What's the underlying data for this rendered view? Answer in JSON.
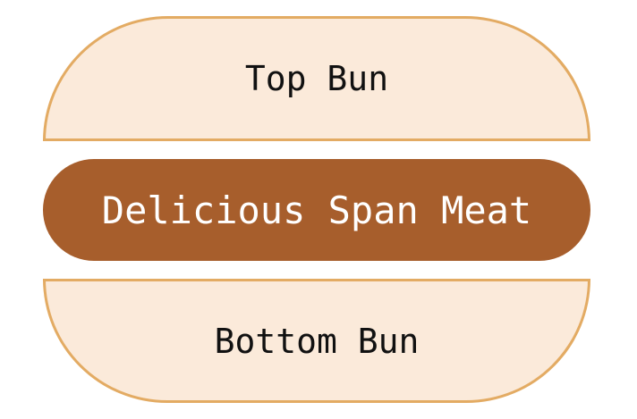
{
  "burger": {
    "top_bun_label": "Top Bun",
    "patty_label": "Delicious Span Meat",
    "bottom_bun_label": "Bottom Bun"
  },
  "colors": {
    "bun_fill": "#fbeada",
    "bun_border": "#e3ab63",
    "patty_fill": "#a75e2c"
  }
}
